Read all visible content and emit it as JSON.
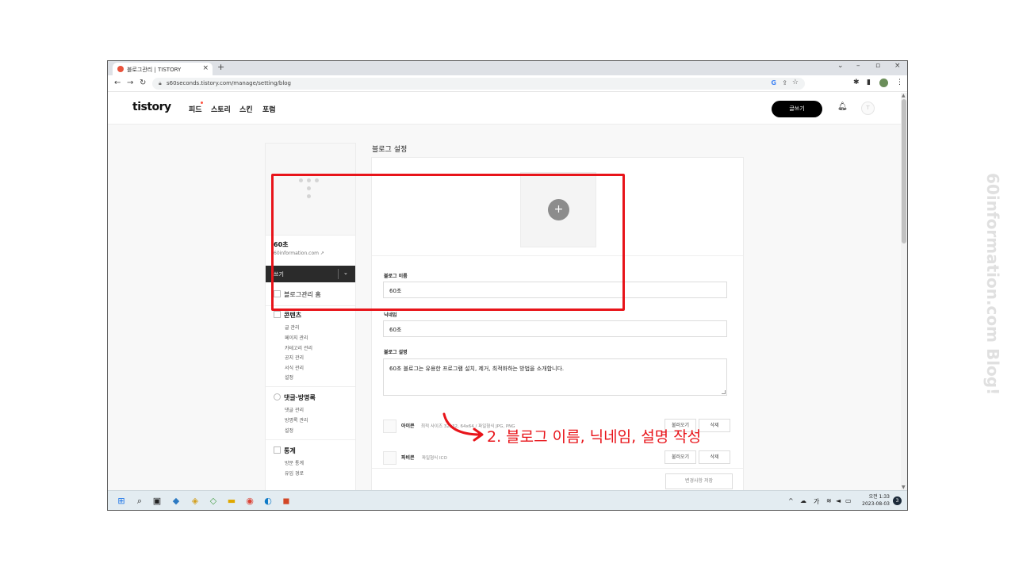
{
  "browser": {
    "tab_title": "블로그관리 | TISTORY",
    "tab_close": "×",
    "new_tab": "+",
    "url": "s60seconds.tistory.com/manage/setting/blog",
    "controls": {
      "minimize": "–",
      "restore": "▫",
      "close": "×",
      "menu": "⌄"
    }
  },
  "header": {
    "logo": "tistory",
    "nav": [
      "피드",
      "스토리",
      "스킨",
      "포럼"
    ],
    "write_button": "글쓰기"
  },
  "sidebar": {
    "blog_name": "60초",
    "blog_url": "60information.com",
    "write": "쓰기",
    "home": "블로그관리 홈",
    "sections": [
      {
        "title": "콘텐츠",
        "items": [
          "글 관리",
          "페이지 관리",
          "카테고리 관리",
          "공지 관리",
          "서식 관리",
          "설정"
        ]
      },
      {
        "title": "댓글·방명록",
        "items": [
          "댓글 관리",
          "방명록 관리",
          "설정"
        ]
      },
      {
        "title": "통계",
        "items": [
          "방문 통계",
          "유입 경로"
        ]
      }
    ]
  },
  "main": {
    "title": "블로그 설정",
    "fields": {
      "name_label": "블로그 이름",
      "name_value": "60초",
      "nick_label": "닉네임",
      "nick_value": "60초",
      "desc_label": "블로그 설명",
      "desc_value": "60초 블로그는 유용한 프로그램 설치, 제거, 최적화하는 방법을 소개합니다."
    },
    "icon_row": {
      "label": "아이콘",
      "desc": "최적 사이즈 32x32, 64x64 / 파일형식 JPG, PNG",
      "load": "불러오기",
      "delete": "삭제"
    },
    "favicon_row": {
      "label": "파비콘",
      "desc": "파일형식 ICO",
      "load": "불러오기",
      "delete": "삭제"
    },
    "save_button": "변경사항 저장"
  },
  "annotation": "2. 블로그 이름, 닉네임, 설명 작성",
  "taskbar": {
    "time": "오전 1:33",
    "date": "2023-08-03",
    "ime": "가",
    "notifications": "3"
  },
  "watermark": "60information.com Blog!",
  "colors": {
    "highlight": "#e8141a",
    "dark_button": "#000000"
  }
}
